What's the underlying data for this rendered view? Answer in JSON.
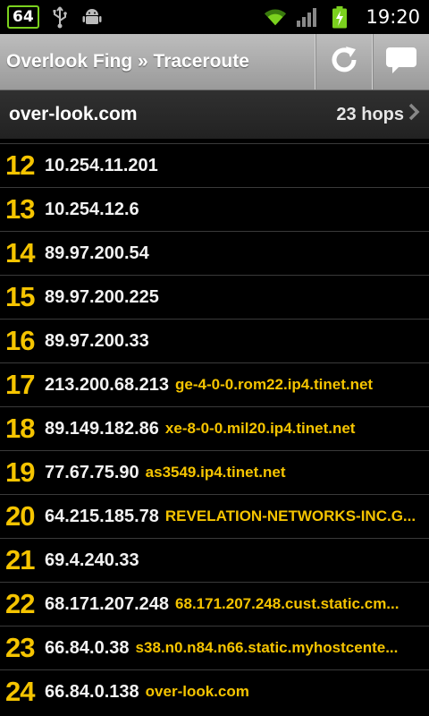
{
  "statusbar": {
    "notification_count": "64",
    "time": "19:20",
    "icons": [
      "usb-icon",
      "android-debug-icon",
      "wifi-icon",
      "signal-icon",
      "battery-charging-icon"
    ]
  },
  "actionbar": {
    "title": "Overlook Fing » Traceroute",
    "icons": [
      "refresh-icon",
      "comment-icon"
    ]
  },
  "target": {
    "host": "over-look.com",
    "hops_label": "23 hops"
  },
  "hops": [
    {
      "num": "12",
      "ip": "10.254.11.201",
      "host": ""
    },
    {
      "num": "13",
      "ip": "10.254.12.6",
      "host": ""
    },
    {
      "num": "14",
      "ip": "89.97.200.54",
      "host": ""
    },
    {
      "num": "15",
      "ip": "89.97.200.225",
      "host": ""
    },
    {
      "num": "16",
      "ip": "89.97.200.33",
      "host": ""
    },
    {
      "num": "17",
      "ip": "213.200.68.213",
      "host": "ge-4-0-0.rom22.ip4.tinet.net"
    },
    {
      "num": "18",
      "ip": "89.149.182.86",
      "host": "xe-8-0-0.mil20.ip4.tinet.net"
    },
    {
      "num": "19",
      "ip": "77.67.75.90",
      "host": "as3549.ip4.tinet.net"
    },
    {
      "num": "20",
      "ip": "64.215.185.78",
      "host": "REVELATION-NETWORKS-INC.G..."
    },
    {
      "num": "21",
      "ip": "69.4.240.33",
      "host": ""
    },
    {
      "num": "22",
      "ip": "68.171.207.248",
      "host": "68.171.207.248.cust.static.cm..."
    },
    {
      "num": "23",
      "ip": "66.84.0.38",
      "host": "s38.n0.n84.n66.static.myhostcente..."
    },
    {
      "num": "24",
      "ip": "66.84.0.138",
      "host": "over-look.com"
    }
  ],
  "colors": {
    "hop_number": "#f5c400",
    "hostname": "#f5c400",
    "background": "#000000"
  }
}
